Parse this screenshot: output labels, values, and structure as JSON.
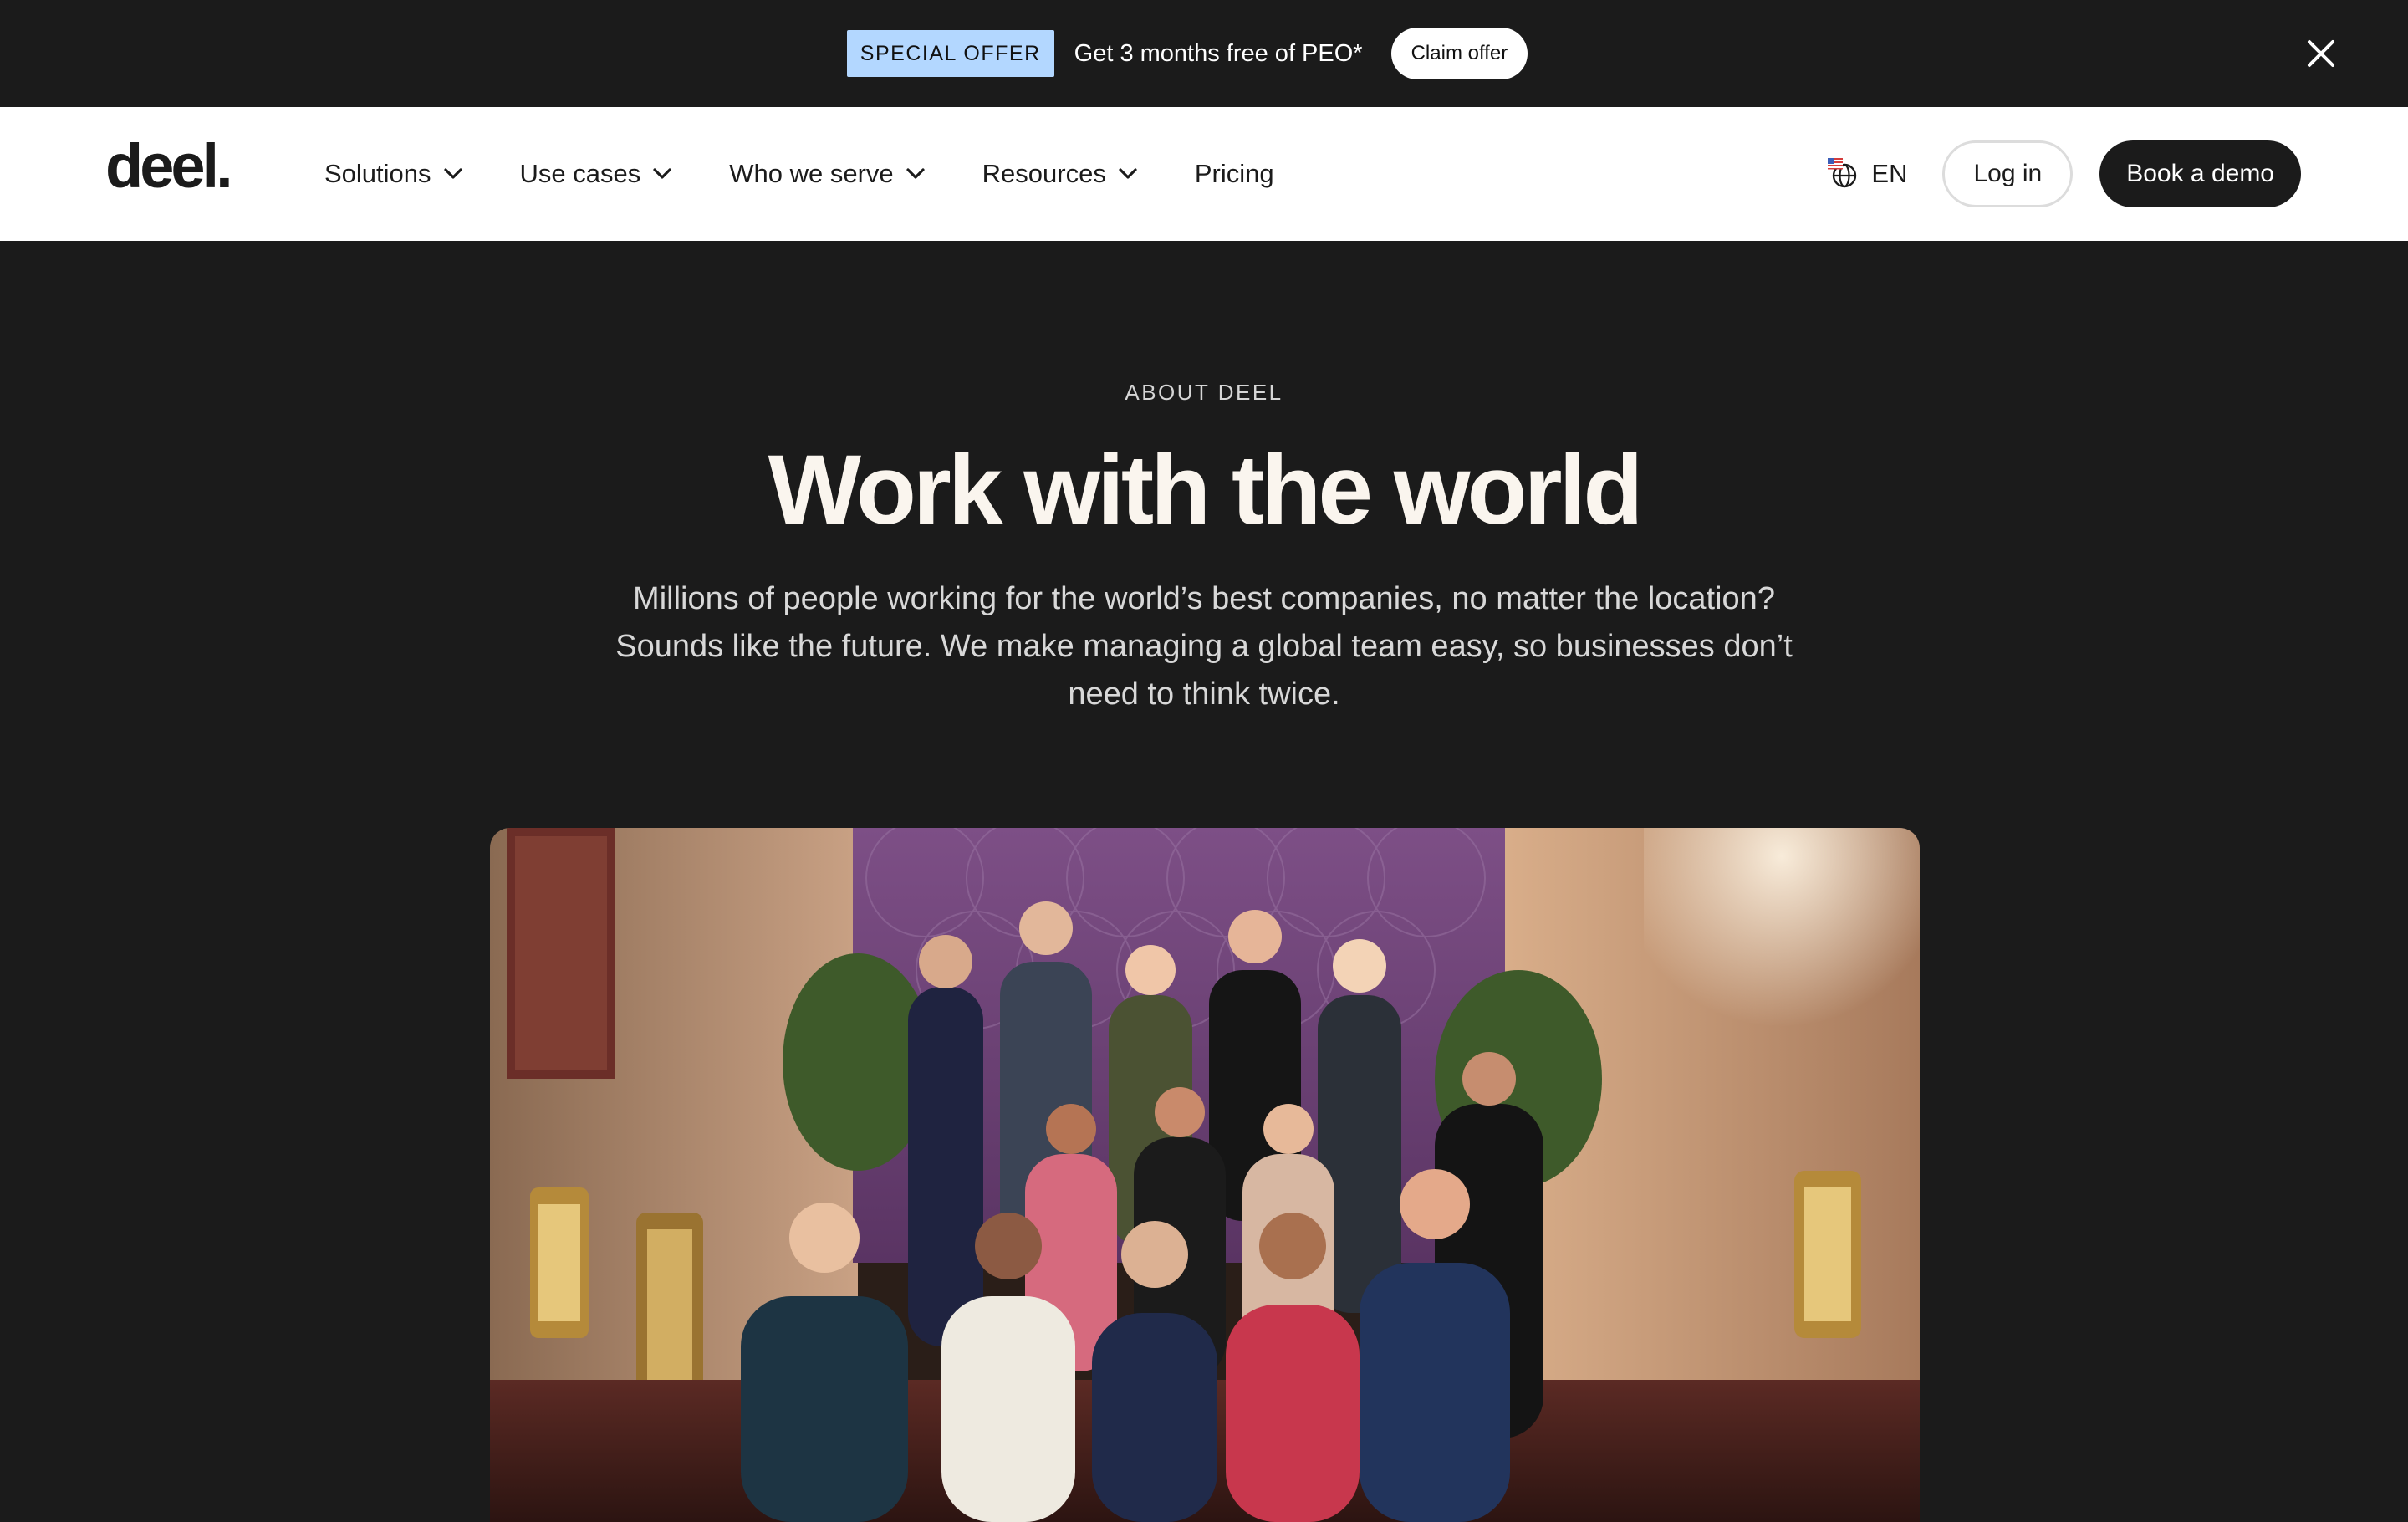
{
  "promo": {
    "badge": "SPECIAL OFFER",
    "text": "Get 3 months free of PEO*",
    "cta": "Claim offer",
    "close_icon": "close-icon"
  },
  "nav": {
    "logo": "deel.",
    "links": [
      {
        "label": "Solutions",
        "has_dropdown": true
      },
      {
        "label": "Use cases",
        "has_dropdown": true
      },
      {
        "label": "Who we serve",
        "has_dropdown": true
      },
      {
        "label": "Resources",
        "has_dropdown": true
      },
      {
        "label": "Pricing",
        "has_dropdown": false
      }
    ],
    "language": "EN",
    "login": "Log in",
    "demo": "Book a demo"
  },
  "hero": {
    "eyebrow": "ABOUT DEEL",
    "title": "Work with the world",
    "subtitle": "Millions of people working for the world’s best companies, no matter the location? Sounds like the future. We make managing a global team easy, so businesses don’t need to think twice."
  },
  "colors": {
    "background": "#1b1b1b",
    "badge": "#b3d7ff",
    "title": "#faf5ee"
  }
}
